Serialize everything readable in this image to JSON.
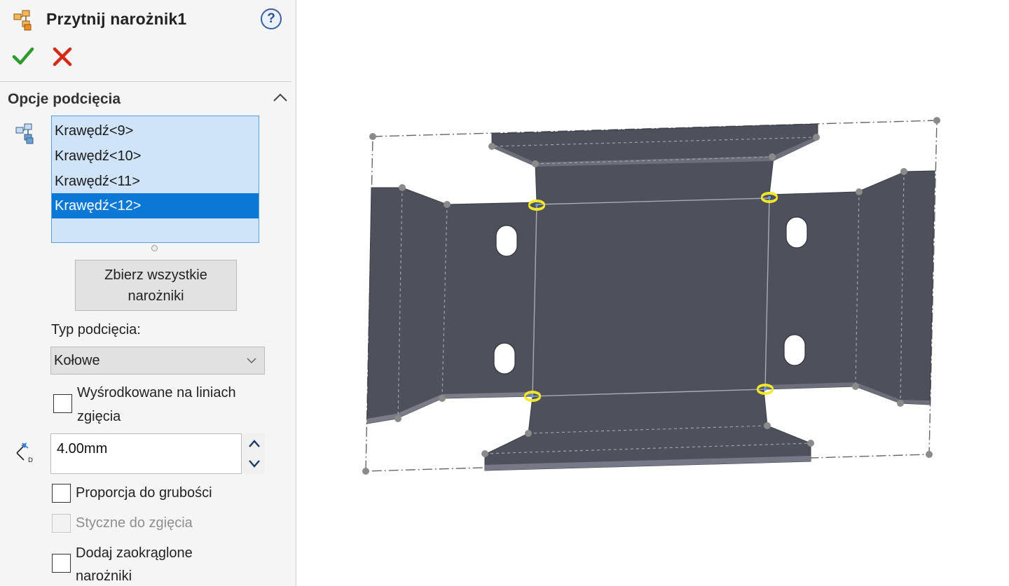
{
  "header": {
    "title": "Przytnij narożnik1",
    "feature_icon": "corner-relief-icon",
    "help_label": "?",
    "ok_icon": "checkmark-icon",
    "cancel_icon": "close-icon"
  },
  "relief_options": {
    "group_title": "Opcje podcięcia",
    "edges": [
      {
        "label": "Krawędź<9>",
        "selected": false
      },
      {
        "label": "Krawędź<10>",
        "selected": false
      },
      {
        "label": "Krawędź<11>",
        "selected": false
      },
      {
        "label": "Krawędź<12>",
        "selected": true
      }
    ],
    "collect_button": {
      "line1": "Zbierz wszystkie",
      "line2": "narożniki"
    },
    "relief_type_label": "Typ podcięcia:",
    "relief_type_value": "Kołowe",
    "centered_on_bend": {
      "line1": "Wyśrodkowane na liniach",
      "line2": "zgięcia",
      "checked": false
    },
    "distance_value": "4.00mm",
    "ratio_to_thickness": {
      "label": "Proporcja do grubości",
      "checked": false
    },
    "tangent_to_bend": {
      "label": "Styczne do zgięcia",
      "checked": false,
      "enabled": false
    },
    "add_fillet_corners": {
      "line1": "Dodaj zaokrąglone",
      "line2": "narożniki",
      "checked": false
    }
  },
  "colors": {
    "selection": "#0a78d4",
    "listbox_bg": "#cfe4f8",
    "part_face": "#4e505c",
    "ok_green": "#2e9a2e",
    "cancel_red": "#d42a16",
    "relief_marker": "#f2e82c"
  }
}
